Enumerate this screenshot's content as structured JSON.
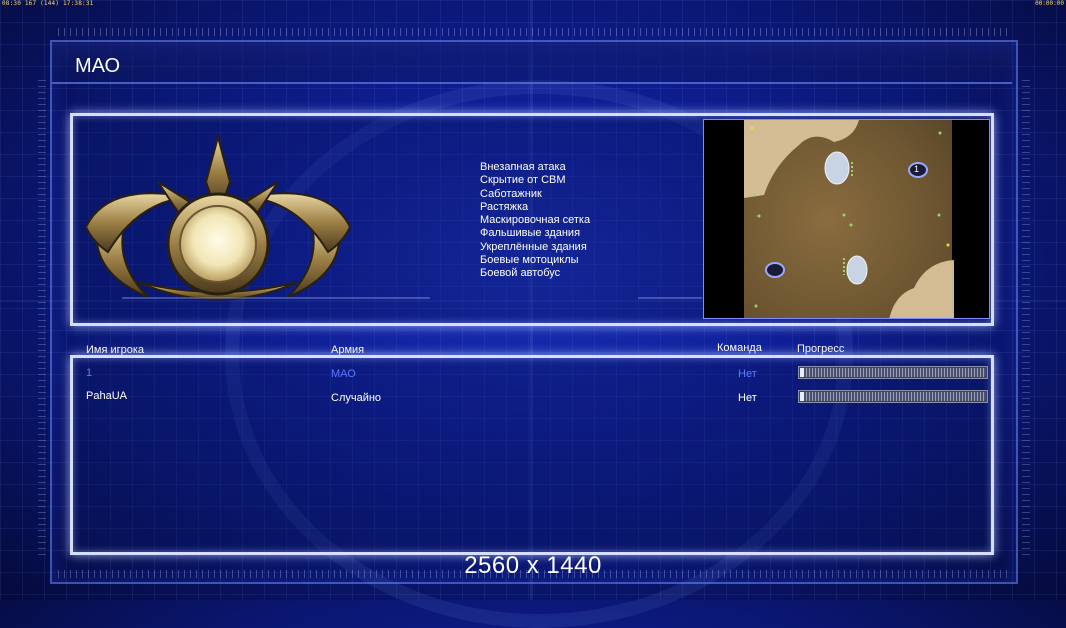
{
  "status_bar": {
    "left": "08:30 167 (144) 17:38:31",
    "right": "00:00:00"
  },
  "faction": {
    "title": "МАО",
    "emblem_icon": "faction-emblem-icon",
    "perks": [
      "Внезапная атака",
      "Скрытие от СВМ",
      "Саботажник",
      "Растяжка",
      "Маскировочная сетка",
      "Фальшивые здания",
      "Укреплённые здания",
      "Боевые мотоциклы",
      "Боевой автобус"
    ]
  },
  "minimap": {
    "start_marker_label": "1"
  },
  "players_table": {
    "headers": {
      "player_name": "Имя игрока",
      "army": "Армия",
      "team": "Команда",
      "progress": "Прогресс"
    },
    "rows": [
      {
        "player": "1",
        "army": "МАО",
        "team": "Нет",
        "progress": 0.01,
        "color": "#5b78ff"
      },
      {
        "player": "PahaUA",
        "army": "Случайно",
        "team": "Нет",
        "progress": 0.01,
        "color": "#ffffff"
      }
    ]
  },
  "resolution_label": "2560 x 1440",
  "colors": {
    "background": "#0f1f96",
    "panel_border": "#d6ddff",
    "player_highlight": "#5b78ff"
  }
}
